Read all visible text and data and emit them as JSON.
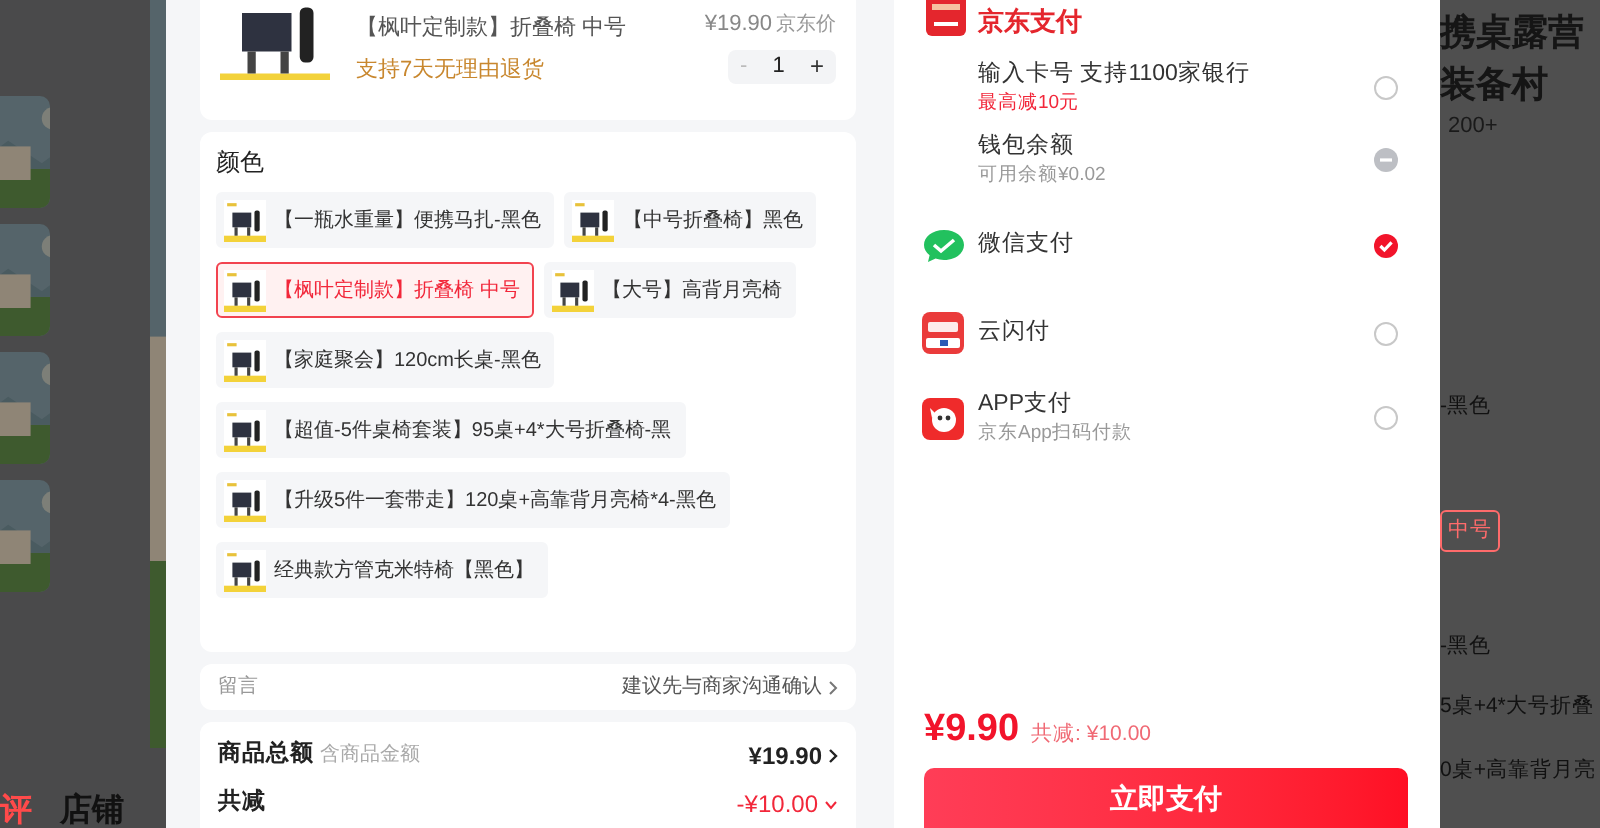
{
  "background_left": {
    "tabs": [
      {
        "label": "评",
        "selected": true
      },
      {
        "label": "店铺",
        "selected": false
      }
    ]
  },
  "background_right": {
    "title_lines": [
      "携桌露营",
      "装备村"
    ],
    "count": "200+",
    "texts": [
      "-黑色",
      "中号",
      "-黑色",
      "5桌+4*大号折叠",
      "0桌+高靠背月亮"
    ]
  },
  "product": {
    "title": "【枫叶定制款】折叠椅 中号",
    "promise": "支持7天无理由退货",
    "price": "¥19.90",
    "price_label": "京东价",
    "quantity": "1",
    "minus": "-",
    "plus": "+"
  },
  "color_section": {
    "title": "颜色",
    "options": [
      {
        "label": "【一瓶水重量】便携马扎-黑色",
        "selected": false
      },
      {
        "label": "【中号折叠椅】黑色",
        "selected": false
      },
      {
        "label": "【枫叶定制款】折叠椅 中号",
        "selected": true
      },
      {
        "label": "【大号】高背月亮椅",
        "selected": false
      },
      {
        "label": "【家庭聚会】120cm长桌-黑色",
        "selected": false
      },
      {
        "label": "【超值-5件桌椅套装】95桌+4*大号折叠椅-黑",
        "selected": false
      },
      {
        "label": "【升级5件一套带走】120桌+高靠背月亮椅*4-黑色",
        "selected": false
      },
      {
        "label": "经典款方管克米特椅【黑色】",
        "selected": false
      }
    ]
  },
  "note": {
    "label": "留言",
    "hint": "建议先与商家沟通确认"
  },
  "summary": [
    {
      "kind": "total",
      "label": "商品总额",
      "sublabel": "含商品金额",
      "value": "¥19.90"
    },
    {
      "kind": "discount",
      "label": "共减",
      "value": "-¥10.00"
    }
  ],
  "payment": {
    "header": "京东支付",
    "methods": [
      {
        "title": "输入卡号 支持1100家银行",
        "subtitle": "最高减10元",
        "subtitle_highlighted": true,
        "selected": false,
        "disabled": false
      },
      {
        "title": "钱包余额",
        "subtitle": "可用余额¥0.02",
        "subtitle_highlighted": false,
        "selected": false,
        "disabled": true
      },
      {
        "title": "微信支付",
        "selected": true,
        "disabled": false
      },
      {
        "title": "云闪付",
        "selected": false,
        "disabled": false
      },
      {
        "title": "APP支付",
        "subtitle": "京东App扫码付款",
        "subtitle_highlighted": false,
        "selected": false,
        "disabled": false
      }
    ],
    "total": "¥9.90",
    "discount": "共减: ¥10.00",
    "button": "立即支付"
  }
}
